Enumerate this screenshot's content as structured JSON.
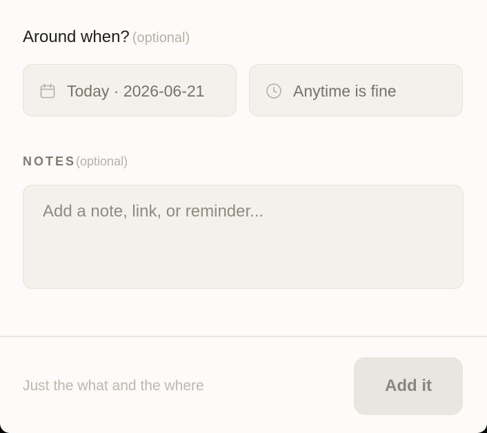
{
  "when": {
    "label": "Around when?",
    "optional_label": "(optional)",
    "date": {
      "icon": "calendar-icon",
      "value": "Today · 2026-06-21"
    },
    "time": {
      "icon": "clock-icon",
      "value": "Anytime is fine"
    }
  },
  "notes": {
    "label": "NOTES",
    "optional_label": "(optional)",
    "value": "",
    "placeholder": "Add a note, link, or reminder..."
  },
  "footer": {
    "hint": "Just the what and the where",
    "submit_label": "Add it"
  },
  "colors": {
    "panel_bg": "#fcfbf9",
    "field_bg": "#f3f1ec",
    "field_border": "#e4e1da",
    "button_bg": "#e9e6df",
    "muted_text": "#b7b2a8"
  }
}
